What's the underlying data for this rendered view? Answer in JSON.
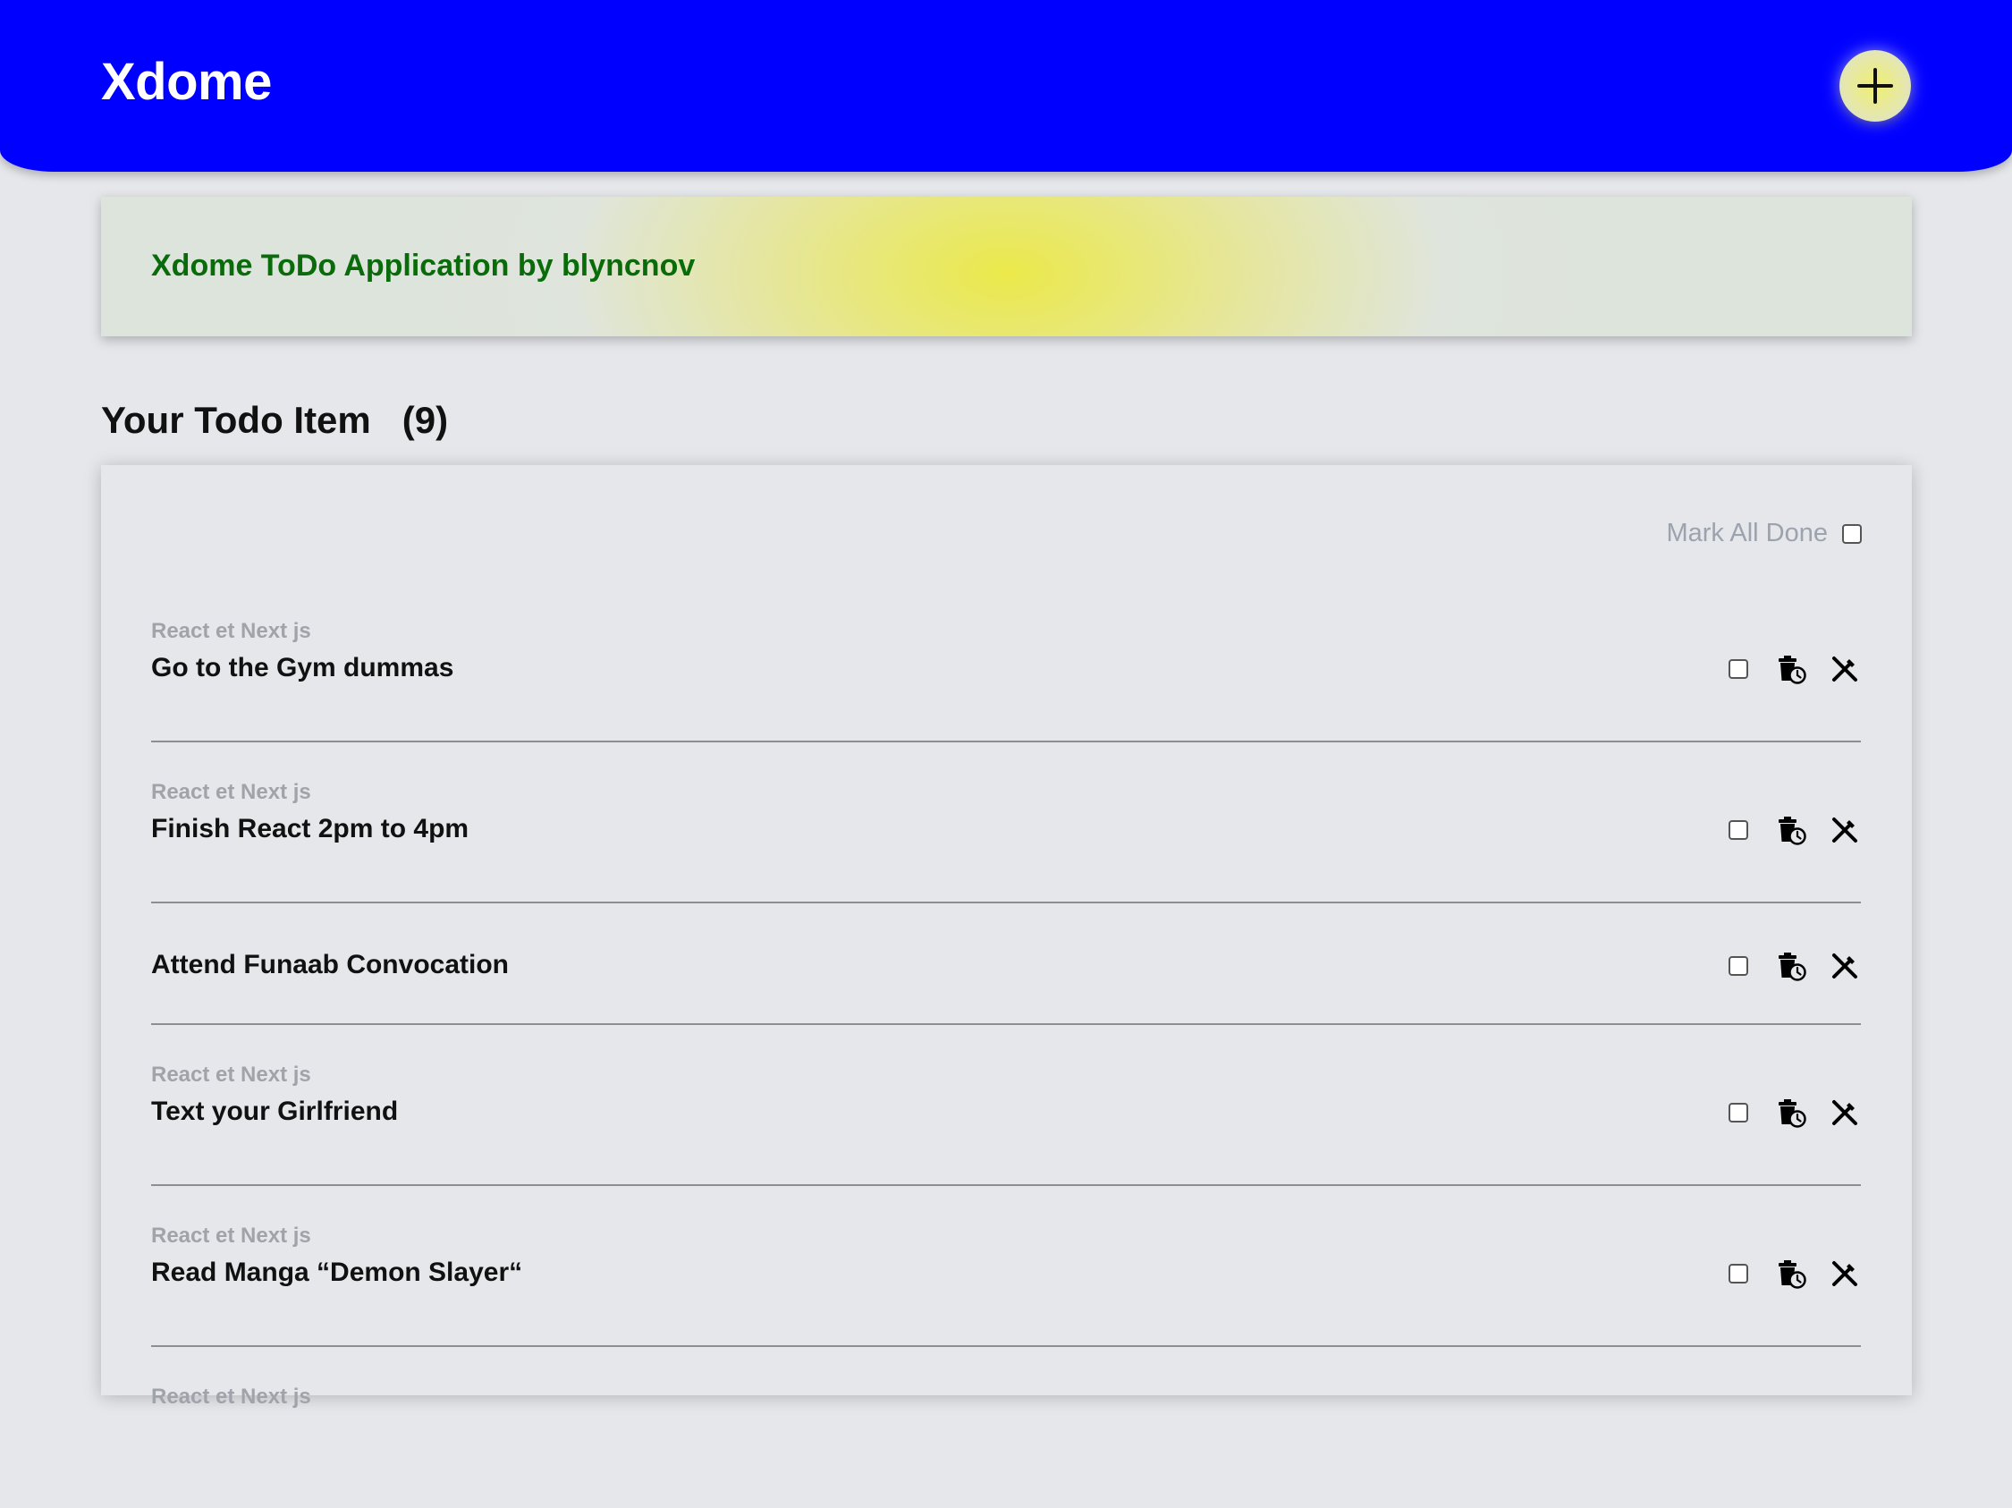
{
  "header": {
    "title": "Xdome",
    "add_icon": "plus-icon"
  },
  "banner": {
    "text": "Xdome ToDo Application by blyncnov"
  },
  "list": {
    "heading": "Your Todo Item",
    "count": "(9)",
    "mark_all_label": "Mark All Done",
    "items": [
      {
        "tag": "React et Next js",
        "title": "Go to the Gym dummas"
      },
      {
        "tag": "React et Next js",
        "title": "Finish React 2pm to 4pm"
      },
      {
        "tag": "",
        "title": "Attend Funaab Convocation"
      },
      {
        "tag": "React et Next js",
        "title": "Text your Girlfriend"
      },
      {
        "tag": "React et Next js",
        "title": "Read Manga “Demon Slayer“"
      },
      {
        "tag": "React et Next js",
        "title": ""
      }
    ]
  },
  "colors": {
    "header_bg": "#0000ff",
    "banner_text": "#0a6b0a",
    "page_bg": "#e5e7eb",
    "muted_text": "#9ca3af"
  },
  "icons": [
    "plus-icon",
    "trash-clock-icon",
    "edit-cross-icon"
  ]
}
